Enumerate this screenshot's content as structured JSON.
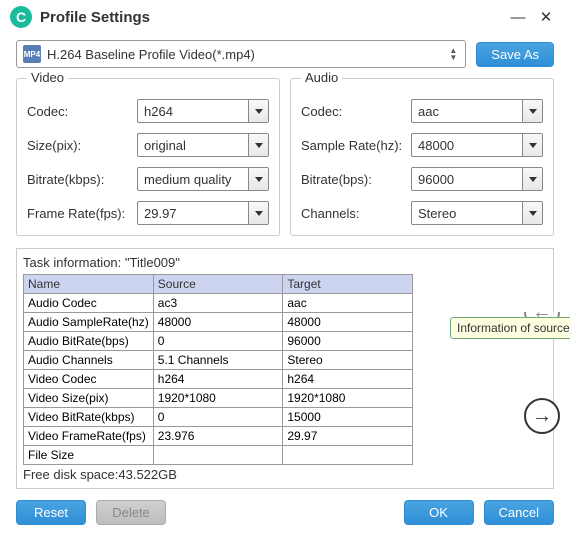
{
  "title": "Profile Settings",
  "window": {
    "min": "—",
    "close": "✕"
  },
  "profile": {
    "text": "H.264 Baseline Profile Video(*.mp4)",
    "icon": "MP4"
  },
  "buttons": {
    "saveAs": "Save As",
    "reset": "Reset",
    "delete": "Delete",
    "ok": "OK",
    "cancel": "Cancel"
  },
  "video": {
    "legend": "Video",
    "codec": {
      "label": "Codec:",
      "value": "h264"
    },
    "size": {
      "label": "Size(pix):",
      "value": "original"
    },
    "bitrate": {
      "label": "Bitrate(kbps):",
      "value": "medium quality"
    },
    "framerate": {
      "label": "Frame Rate(fps):",
      "value": "29.97"
    }
  },
  "audio": {
    "legend": "Audio",
    "codec": {
      "label": "Codec:",
      "value": "aac"
    },
    "samplerate": {
      "label": "Sample Rate(hz):",
      "value": "48000"
    },
    "bitrate": {
      "label": "Bitrate(bps):",
      "value": "96000"
    },
    "channels": {
      "label": "Channels:",
      "value": "Stereo"
    }
  },
  "task": {
    "title": "Task information: \"Title009\"",
    "headers": {
      "name": "Name",
      "source": "Source",
      "target": "Target"
    },
    "rows": [
      {
        "name": "Audio Codec",
        "source": "ac3",
        "target": "aac"
      },
      {
        "name": "Audio SampleRate(hz)",
        "source": "48000",
        "target": "48000"
      },
      {
        "name": "Audio BitRate(bps)",
        "source": "0",
        "target": "96000"
      },
      {
        "name": "Audio Channels",
        "source": "5.1 Channels",
        "target": "Stereo"
      },
      {
        "name": "Video Codec",
        "source": "h264",
        "target": "h264"
      },
      {
        "name": "Video Size(pix)",
        "source": "1920*1080",
        "target": "1920*1080"
      },
      {
        "name": "Video BitRate(kbps)",
        "source": "0",
        "target": "15000"
      },
      {
        "name": "Video FrameRate(fps)",
        "source": "23.976",
        "target": "29.97"
      },
      {
        "name": "File Size",
        "source": "",
        "target": ""
      }
    ],
    "freespace": "Free disk space:43.522GB"
  },
  "tooltip": "Information of source",
  "nav": {
    "prev": "←",
    "next": "→"
  }
}
